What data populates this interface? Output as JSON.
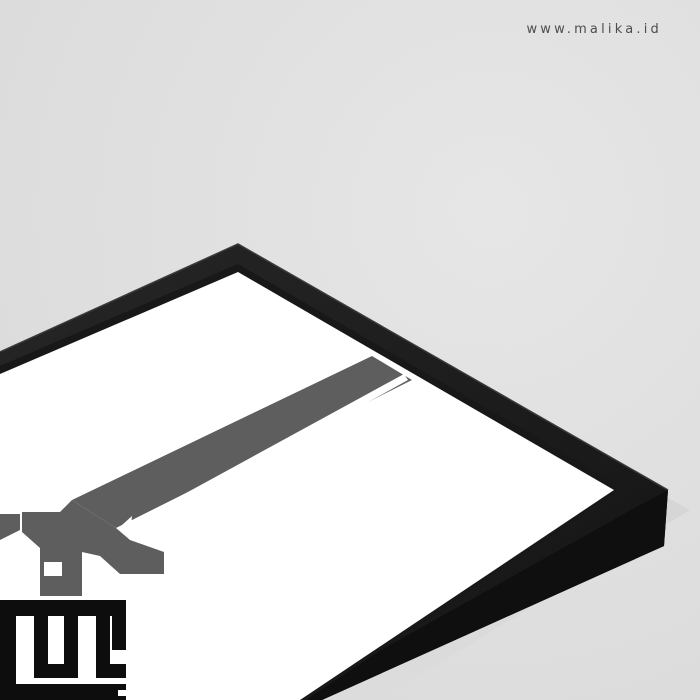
{
  "watermark": {
    "text": "www.malika.id"
  },
  "colors": {
    "background": "#e2e2e2",
    "frame": "#1c1c1c",
    "frame_edge": "#0c0c0c",
    "frame_top_highlight": "#2b2b2b",
    "canvas": "#ffffff",
    "calligraphy_gray": "#5e5e5e",
    "calligraphy_black": "#0d0d0d"
  },
  "icons": {
    "artwork": "kufic-calligraphy-print",
    "frame": "black-picture-frame"
  }
}
